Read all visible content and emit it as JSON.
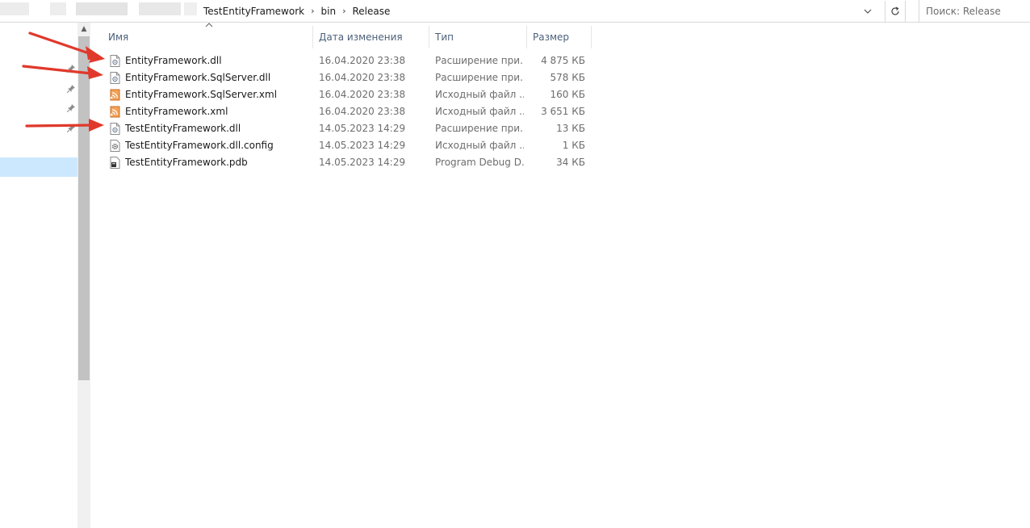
{
  "address_bar": {
    "breadcrumbs": [
      "TestEntityFramework",
      "bin",
      "Release"
    ],
    "separator": "›",
    "dropdown_icon": "chevron-down",
    "refresh_icon": "refresh"
  },
  "search": {
    "placeholder": "Поиск: Release"
  },
  "columns": {
    "name": "Имя",
    "date": "Дата изменения",
    "type": "Тип",
    "size": "Размер",
    "sort_icon": "sort-ascending"
  },
  "files": [
    {
      "name": "EntityFramework.dll",
      "date": "16.04.2020 23:38",
      "type": "Расширение при...",
      "size": "4 875 КБ",
      "icon": "dll-icon"
    },
    {
      "name": "EntityFramework.SqlServer.dll",
      "date": "16.04.2020 23:38",
      "type": "Расширение при...",
      "size": "578 КБ",
      "icon": "dll-icon"
    },
    {
      "name": "EntityFramework.SqlServer.xml",
      "date": "16.04.2020 23:38",
      "type": "Исходный файл ...",
      "size": "160 КБ",
      "icon": "xml-icon"
    },
    {
      "name": "EntityFramework.xml",
      "date": "16.04.2020 23:38",
      "type": "Исходный файл ...",
      "size": "3 651 КБ",
      "icon": "xml-icon"
    },
    {
      "name": "TestEntityFramework.dll",
      "date": "14.05.2023 14:29",
      "type": "Расширение при...",
      "size": "13 КБ",
      "icon": "dll-icon"
    },
    {
      "name": "TestEntityFramework.dll.config",
      "date": "14.05.2023 14:29",
      "type": "Исходный файл ...",
      "size": "1 КБ",
      "icon": "config-icon"
    },
    {
      "name": "TestEntityFramework.pdb",
      "date": "14.05.2023 14:29",
      "type": "Program Debug D...",
      "size": "34 КБ",
      "icon": "pdb-icon"
    }
  ],
  "annotation_color": "#e0392b",
  "selection_color": "#cce8ff"
}
